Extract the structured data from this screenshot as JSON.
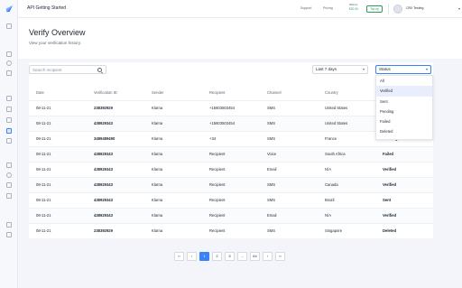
{
  "app": {
    "title": "API Getting Started"
  },
  "topbar": {
    "nav": [
      "Support",
      "Pricing"
    ],
    "balance_label": "Balance",
    "balance_value": "€20.00",
    "topup_label": "Top up",
    "user_name": "CRX Testing"
  },
  "page": {
    "title": "Verify Overview",
    "subtitle": "View your verification history."
  },
  "filters": {
    "search_placeholder": "Search recipient",
    "date_range": "Last 7 days",
    "status_placeholder": "Status",
    "status_options": [
      "All",
      "Verified",
      "Sent",
      "Pending",
      "Failed",
      "Deleted"
    ],
    "status_highlighted": "Verified"
  },
  "table": {
    "columns": [
      "Date",
      "Verification ID",
      "Sender",
      "Recipient",
      "Channel",
      "Country",
      "Status"
    ],
    "rows": [
      [
        "08-11-21",
        "238392929",
        "Klarna",
        "+15603503454",
        "SMS",
        "United States",
        ""
      ],
      [
        "08-11-21",
        "438929343",
        "Klarna",
        "+15603503454",
        "SMS",
        "United States",
        ""
      ],
      [
        "08-11-21",
        "3489489490",
        "Klarna",
        "+34",
        "SMS",
        "France",
        "Pending"
      ],
      [
        "08-11-21",
        "438929343",
        "Klarna",
        "Recipient",
        "Voice",
        "South Africa",
        "Failed"
      ],
      [
        "08-11-21",
        "438929343",
        "Klarna",
        "Recipient",
        "Email",
        "N/A",
        "Verified"
      ],
      [
        "08-11-21",
        "438929343",
        "Klarna",
        "Recipient",
        "SMS",
        "Canada",
        "Verified"
      ],
      [
        "08-11-21",
        "438929343",
        "Klarna",
        "Recipient",
        "SMS",
        "Brazil",
        "Sent"
      ],
      [
        "08-11-21",
        "438929343",
        "Klarna",
        "Recipient",
        "Email",
        "N/A",
        "Verified"
      ],
      [
        "08-11-21",
        "238392929",
        "Klarna",
        "Recipient",
        "SMS",
        "Singapore",
        "Deleted"
      ]
    ]
  },
  "pagination": {
    "items": [
      "‹‹",
      "‹",
      "1",
      "2",
      "3",
      "...",
      "64",
      "›",
      "››"
    ],
    "current": "1"
  },
  "colors": {
    "accent": "#3b82f6",
    "success": "#2d9c5a"
  }
}
